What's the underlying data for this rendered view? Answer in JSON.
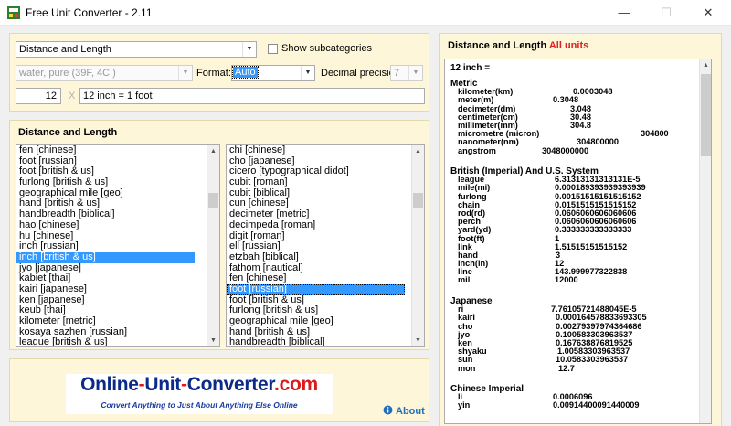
{
  "window": {
    "title": "Free Unit Converter - 2.11",
    "controls": {
      "minimize": "—",
      "maximize": "☐",
      "close": "✕"
    }
  },
  "top_panel": {
    "category": "Distance and Length",
    "show_subcategories": "Show subcategories",
    "substance": "water, pure (39F, 4C )",
    "format_label": "Format:",
    "format_value": "Auto",
    "precision_label": "Decimal precision:",
    "precision_value": "7",
    "amount": "12",
    "clear_symbol": "X",
    "conversion": "12 inch = 1 foot"
  },
  "lists_panel": {
    "title": "Distance and Length",
    "from_units": [
      "fen [chinese]",
      "foot [russian]",
      "foot [british & us]",
      "furlong [british & us]",
      "geographical mile [geo]",
      "hand [british & us]",
      "handbreadth [biblical]",
      "hao [chinese]",
      "hu [chinese]",
      "inch [russian]",
      "inch [british & us]",
      "jyo [japanese]",
      "kabiet [thai]",
      "kairi [japanese]",
      "ken [japanese]",
      "keub [thai]",
      "kilometer [metric]",
      "kosaya sazhen [russian]",
      "league [british & us]"
    ],
    "from_selected_index": 10,
    "to_units": [
      "chi [chinese]",
      "cho [japanese]",
      "cicero [typographical didot]",
      "cubit [roman]",
      "cubit [biblical]",
      "cun [chinese]",
      "decimeter [metric]",
      "decimpeda [roman]",
      "digit [roman]",
      "ell [russian]",
      "etzbah [biblical]",
      "fathom [nautical]",
      "fen [chinese]",
      "foot [russian]",
      "foot [british & us]",
      "furlong [british & us]",
      "geographical mile [geo]",
      "hand [british & us]",
      "handbreadth [biblical]"
    ],
    "to_selected_index": 13
  },
  "results": {
    "title": "Distance and Length",
    "title_suffix": "All units",
    "header": "12 inch =",
    "groups": [
      {
        "name": "Metric",
        "rows": [
          {
            "unit": "kilometer(km)",
            "value": "0.0003048"
          },
          {
            "unit": "meter(m)",
            "value": "0.3048"
          },
          {
            "unit": "decimeter(dm)",
            "value": "3.048"
          },
          {
            "unit": "centimeter(cm)",
            "value": "30.48"
          },
          {
            "unit": "millimeter(mm)",
            "value": "304.8"
          },
          {
            "unit": "micrometre (micron)",
            "value": "304800"
          },
          {
            "unit": "nanometer(nm)",
            "value": "304800000"
          },
          {
            "unit": "angstrom",
            "value": "3048000000"
          }
        ]
      },
      {
        "name": "British (Imperial) And U.S. System",
        "rows": [
          {
            "unit": "league",
            "value": "6.31313131313131E-5"
          },
          {
            "unit": "mile(mi)",
            "value": "0.000189393939393939"
          },
          {
            "unit": "furlong",
            "value": "0.00151515151515152"
          },
          {
            "unit": "chain",
            "value": "0.0151515151515152"
          },
          {
            "unit": "rod(rd)",
            "value": "0.0606060606060606"
          },
          {
            "unit": "perch",
            "value": "0.0606060606060606"
          },
          {
            "unit": "yard(yd)",
            "value": "0.333333333333333"
          },
          {
            "unit": "foot(ft)",
            "value": "1"
          },
          {
            "unit": "link",
            "value": "1.51515151515152"
          },
          {
            "unit": "hand",
            "value": "3"
          },
          {
            "unit": "inch(in)",
            "value": "12"
          },
          {
            "unit": "line",
            "value": "143.999977322838"
          },
          {
            "unit": "mil",
            "value": "12000"
          }
        ]
      },
      {
        "name": "Japanese",
        "rows": [
          {
            "unit": "ri",
            "value": "7.76105721488045E-5"
          },
          {
            "unit": "kairi",
            "value": "0.000164578833693305"
          },
          {
            "unit": "cho",
            "value": "0.00279397974364686"
          },
          {
            "unit": "jyo",
            "value": "0.100583303963537"
          },
          {
            "unit": "ken",
            "value": "0.167638876819525"
          },
          {
            "unit": "shyaku",
            "value": "1.00583303963537"
          },
          {
            "unit": "sun",
            "value": "10.0583303963537"
          },
          {
            "unit": "mon",
            "value": "12.7"
          }
        ]
      },
      {
        "name": "Chinese Imperial",
        "rows": [
          {
            "unit": "li",
            "value": "0.0006096"
          },
          {
            "unit": "yin",
            "value": "0.00914400091440009"
          }
        ]
      }
    ]
  },
  "footer": {
    "logo_part1": "Online",
    "logo_part2": "Unit",
    "logo_part3": "Converter",
    "logo_domain": ".com",
    "logo_tagline": "Convert Anything to Just About Anything Else Online",
    "about": "About"
  },
  "colors": {
    "panel_bg": "#fdf6d9",
    "selection": "#3399ff",
    "title_accent": "#e02020",
    "logo_blue": "#0c2a8a",
    "logo_red": "#d81b1b",
    "about_link": "#1f6fbf"
  },
  "icons": {
    "app": "converter-app-icon",
    "about": "info-icon"
  }
}
